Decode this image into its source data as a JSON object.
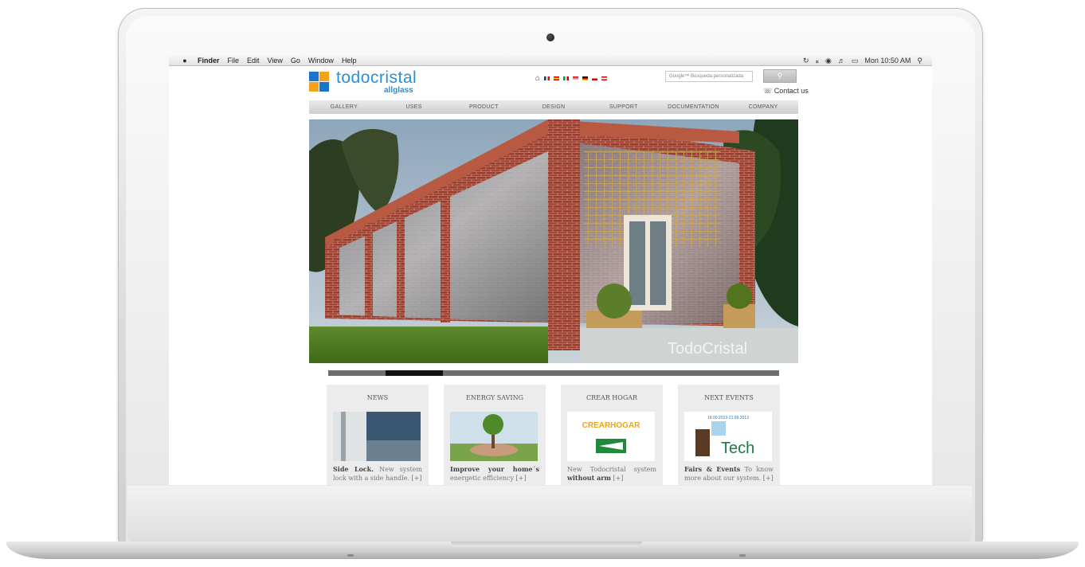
{
  "menubar": {
    "items": [
      "Finder",
      "File",
      "Edit",
      "View",
      "Go",
      "Window",
      "Help"
    ],
    "clock": "Mon 10:50 AM"
  },
  "site": {
    "logo_main": "todocristal",
    "logo_sub": "allglass",
    "search_placeholder": "Google™ Búsqueda personalizada",
    "contact": "Contact us",
    "nav": [
      "GALLERY",
      "USES",
      "PRODUCT",
      "DESIGN",
      "SUPPORT",
      "DOCUMENTATION",
      "COMPANY"
    ],
    "hero_watermark": "TodoCristal",
    "cards": [
      {
        "title": "NEWS",
        "text_bold": "Side Lock.",
        "text": "New system lock with a side handle. [+]"
      },
      {
        "title": "ENERGY SAVING",
        "text_bold": "Improve your home´s",
        "text": "energetic efficiency [+]"
      },
      {
        "title": "CREAR HOGAR",
        "text_pre": "New Todocristal system",
        "text_bold": "without arm",
        "text": "[+]",
        "logo_text": "CREARHOGAR"
      },
      {
        "title": "NEXT EVENTS",
        "text_bold": "Fairs & Events",
        "text": "To know more about our system. [+]",
        "event_dates": "18.09.2013-21.09.2013",
        "event_logo": "Tech"
      }
    ]
  },
  "colors": {
    "brand_blue": "#2a8fd6",
    "brand_orange": "#f2a21c",
    "nav_bg": "#d9d9d9"
  }
}
